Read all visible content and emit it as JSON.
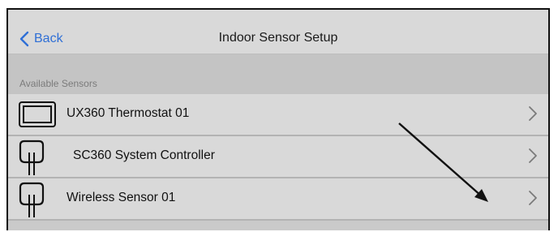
{
  "nav": {
    "back_label": "Back",
    "title": "Indoor Sensor Setup"
  },
  "section": {
    "header": "Available Sensors"
  },
  "sensors": [
    {
      "label": "UX360 Thermostat 01",
      "icon": "thermostat-icon"
    },
    {
      "label": "SC360 System Controller",
      "icon": "sensor-icon"
    },
    {
      "label": "Wireless Sensor 01",
      "icon": "sensor-icon"
    }
  ],
  "colors": {
    "accent": "#2f6fd6",
    "row_bg": "#d9d9d9",
    "section_bg": "#c4c4c4",
    "separator": "#b3b3b3"
  },
  "icons": {
    "back": "chevron-left-icon",
    "row_disclosure": "chevron-right-icon",
    "annotation": "arrow-annotation"
  }
}
